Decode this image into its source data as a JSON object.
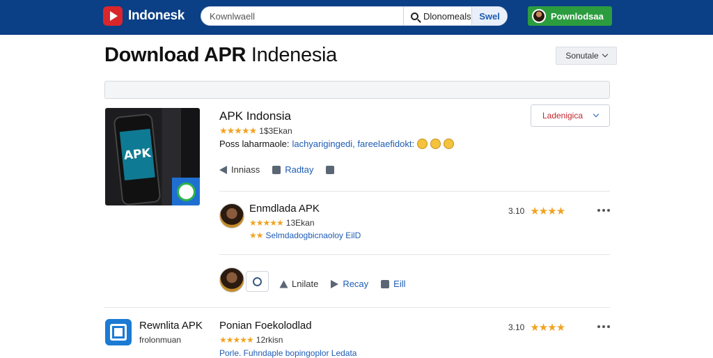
{
  "topbar": {
    "logo_text": "Indonesk",
    "search_placeholder": "Kownlwaell",
    "search_button": "Dlonomeals",
    "search_go": "Swel",
    "download_button": "Pownlodsaa"
  },
  "page": {
    "title_bold": "Download APR",
    "title_rest": "Indenesia",
    "sort_label": "Sonutale"
  },
  "app": {
    "thumb_text": "APK",
    "name": "APK Indonsia",
    "stars": "★★★★★",
    "rating_count": "1$3Ekan",
    "desc_label": "Poss laharmaole:",
    "desc_link": "lachyarigingedi, fareelaefidokt:",
    "language_select": "Ladenigica",
    "actions": {
      "share": "Inniass",
      "reply": "Radtay"
    }
  },
  "reviews": [
    {
      "title": "Enmdlada APK",
      "stars": "★★★★★",
      "count": "13Ekan",
      "line_stars": "★★",
      "line_text": "Selmdadogbicnaoloy EilD",
      "score": "3.10",
      "score_stars": "★★★★"
    }
  ],
  "reply_actions": {
    "like": "Lnilate",
    "reply": "Recay",
    "edit": "Eill"
  },
  "second_app": {
    "name": "Rewnlita APK",
    "subtitle": "frolonmuan",
    "review_title": "Ponian Foekolodlad",
    "stars": "★★★★★",
    "count": "12rkisn",
    "line_text": "Porle. Fuhndaple bopingoplor Ledata",
    "score": "3.10",
    "score_stars": "★★★★"
  }
}
